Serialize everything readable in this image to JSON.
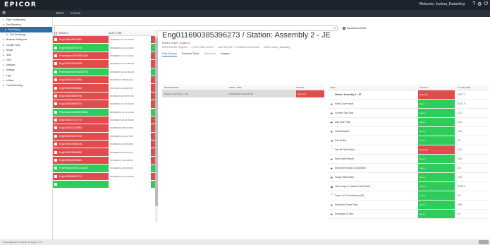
{
  "app": {
    "logo": "EPICOR",
    "welcome": "Welcome, Joshua_Easterling",
    "top_icons": [
      "help-icon",
      "settings-icon",
      "logout-icon"
    ],
    "tabs": [
      "PARTS",
      "ASSEMB"
    ],
    "sidebar_top": "⚙"
  },
  "sidebar": [
    {
      "icon": "▸",
      "label": "Plant Configuration",
      "level": 0
    },
    {
      "icon": "▾",
      "label": "Part Reporting",
      "level": 0
    },
    {
      "icon": "▸",
      "label": "Part History",
      "level": 1,
      "selected": true
    },
    {
      "icon": "▾",
      "label": "Part Genealogy",
      "level": 2
    },
    {
      "icon": "▸",
      "label": "Business Intelligence",
      "level": 0
    },
    {
      "icon": "▸",
      "label": "Contain Parts",
      "level": 0
    },
    {
      "icon": "▸",
      "label": "Repair",
      "level": 0
    },
    {
      "icon": "▸",
      "label": "JEM",
      "level": 0
    },
    {
      "icon": "▸",
      "label": "OEE",
      "level": 0
    },
    {
      "icon": "▸",
      "label": "Statuses",
      "level": 0
    },
    {
      "icon": "▸",
      "label": "Settings",
      "level": 0
    },
    {
      "icon": "▸",
      "label": "Logs",
      "level": 0
    },
    {
      "icon": "▸",
      "label": "eVision",
      "level": 0
    },
    {
      "icon": "▸",
      "label": "Troubleshooting",
      "level": 0
    }
  ],
  "search": {
    "value": "",
    "placeholder": "",
    "advanced_label": "Advanced Criteria",
    "results_label": "Results for:"
  },
  "table": {
    "headers": [
      "SERIAL #",
      "DATE / TIME"
    ],
    "rows": [
      {
        "serial": "Eng011690459746600",
        "date": "07/28/2022 11:43:23 AM",
        "color": "#e04b4b"
      },
      {
        "serial": "Eng011690459707709",
        "date": "07/28/2022 11:39:33 AM",
        "color": "#2ecc5a"
      },
      {
        "serial": "Presentation1690459613528",
        "date": "07/28/2022 11:11:22 AM",
        "color": "#e04b4b"
      },
      {
        "serial": "Eng011690459164438",
        "date": "07/28/2022 10:51:38 AM",
        "color": "#e04b4b"
      },
      {
        "serial": "Presentation1690455467870",
        "date": "07/28/2022 10:22:06 AM",
        "color": "#2ecc5a"
      },
      {
        "serial": "Eng011690401226946",
        "date": "07/27/2022 7:00:00 AM",
        "color": "#e04b4b"
      },
      {
        "serial": "Eng011690398558543",
        "date": "07/27/2022 2:59:00 PM",
        "color": "#e04b4b"
      },
      {
        "serial": "Eng011690368088798",
        "date": "07/26/2022 11:58:07 AM",
        "color": "#e04b4b"
      },
      {
        "serial": "Eng011690385396273",
        "date": "07/26/2022 11:39:03 AM",
        "color": "#e04b4b"
      },
      {
        "serial": "Presentation1690380496000",
        "date": "07/26/2022 11:16:14 AM",
        "color": "#2ecc5a"
      },
      {
        "serial": "Eng011690372107770",
        "date": "07/26/2022 10:46:59 AM",
        "color": "#e04b4b"
      },
      {
        "serial": "Eng011690311208884",
        "date": "07/25/2022 2:58:42 PM",
        "color": "#e04b4b"
      },
      {
        "serial": "Eng011690311207148",
        "date": "07/25/2022 2:54:37 PM",
        "color": "#e04b4b"
      },
      {
        "serial": "Eng011690309082216",
        "date": "07/25/2022 2:22:58 PM",
        "color": "#e04b4b"
      },
      {
        "serial": "Eng011690308154508",
        "date": "07/25/2022 2:20:32 PM",
        "color": "#e04b4b"
      },
      {
        "serial": "Eng011690301965600",
        "date": "07/24/2022 1:30:19 PM",
        "color": "#e04b4b"
      },
      {
        "serial": "Presentation1690211220000",
        "date": "07/24/2022 1:23:49 PM",
        "color": "#2ecc5a"
      },
      {
        "serial": "Eng011689866297141",
        "date": "07/20/2022 10:51:19 AM",
        "color": "#e04b4b"
      },
      {
        "serial": "",
        "date": "",
        "color": "#2ecc5a"
      }
    ]
  },
  "detail": {
    "title": "Eng011690385396273 / Station: Assembly 2 - JE",
    "model": "MODEL: Eng01 - Engine 01",
    "meta": {
      "part_status_label": "PART STATUS:",
      "part_status": "Rejected",
      "cycle_time": "CYCLE TIME: 00:07.2",
      "last_activity": "LAST ACTIVITY: 07/26/2022 11:39:03 AM",
      "user": "USER: Joshua_Easterling"
    },
    "tabs": [
      "Part History",
      "Process Data",
      "Warnings",
      "Images"
    ]
  },
  "desc_table": {
    "headers": [
      "DESCRIPTION",
      "DATE / TIME",
      "STATUS"
    ],
    "row": {
      "description": "Station: Assembly 2 - JE",
      "date": "07/26/2022 11:39:03 AM",
      "status": "Rejected"
    }
  },
  "task_table": {
    "headers": [
      "TASK",
      "STATUS",
      "CYCLE TIME"
    ],
    "rows": [
      {
        "icon": "",
        "task": "Station: Assembly 2 - JE",
        "status": "Rejected",
        "color": "#e04b4b",
        "time": "00:07.2"
      },
      {
        "icon": "☛",
        "task": "Head Cover Install",
        "status": "Good",
        "color": "#2ecc5a",
        "time": "01:37.5"
      },
      {
        "icon": "☛",
        "task": "Connect Gas Tank",
        "status": "Good",
        "color": "#2ecc5a",
        "time": "10.7"
      },
      {
        "icon": "☛",
        "task": "Gas Tank Final",
        "status": "Good",
        "color": "#2ecc5a",
        "time": "19.1"
      },
      {
        "icon": "☛",
        "task": "Install Bracket",
        "status": "Good",
        "color": "#2ecc5a",
        "time": "40.4"
      },
      {
        "icon": "⚒",
        "task": "Pick Muffler",
        "status": "Good",
        "color": "#2ecc5a",
        "time": "6.9"
      },
      {
        "icon": "⌒",
        "task": "Test Fit Heat Shield",
        "status": "Rejected",
        "color": "#e04b4b",
        "time": "04.1"
      },
      {
        "icon": "☛",
        "task": "Heat Shield Repair",
        "status": "Good",
        "color": "#2ecc5a",
        "time": "32.6"
      },
      {
        "icon": "☛",
        "task": "Heat Shield Install & Inspection",
        "status": "Good",
        "color": "#2ecc5a",
        "time": "5.8"
      },
      {
        "icon": "☛",
        "task": "Gauge Heat Shield",
        "status": "Good",
        "color": "#2ecc5a",
        "time": "12.9"
      },
      {
        "icon": "◉",
        "task": "Take Image of Installed Heat Shield",
        "status": "Good",
        "color": "#2ecc5a",
        "time": "01:08.1"
      },
      {
        "icon": "⌒",
        "task": "Torque (10 Connections) (30)",
        "status": "Good",
        "color": "#2ecc5a",
        "time": "6.6"
      },
      {
        "icon": "☛",
        "task": "Simulated Torque Task",
        "status": "Good",
        "color": "#2ecc5a",
        "time": "28.8"
      },
      {
        "icon": "☛",
        "task": "Simulated Oil Task",
        "status": "Good",
        "color": "#2ecc5a",
        "time": "6.2"
      }
    ]
  },
  "footer": {
    "text": "Rows Selected: 1   Results: 33   Page: 1 of 1"
  }
}
